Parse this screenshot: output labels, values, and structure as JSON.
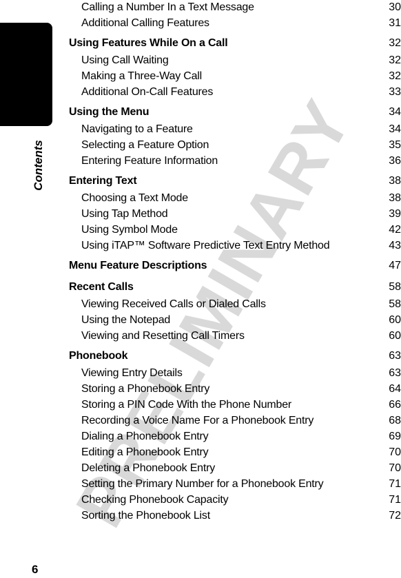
{
  "side_tab": {
    "label": "Contents"
  },
  "page_number": "6",
  "watermark": "PRELIMINARY",
  "toc": [
    {
      "level": "sub",
      "title": "Calling a Number In a Text Message",
      "page": "30"
    },
    {
      "level": "sub",
      "title": "Additional Calling Features",
      "page": "31"
    },
    {
      "level": "section",
      "title": "Using Features While On a Call",
      "page": "32"
    },
    {
      "level": "sub",
      "title": "Using Call Waiting",
      "page": "32"
    },
    {
      "level": "sub",
      "title": "Making a Three-Way Call",
      "page": "32"
    },
    {
      "level": "sub",
      "title": "Additional On-Call Features",
      "page": "33"
    },
    {
      "level": "section",
      "title": "Using the Menu",
      "page": "34"
    },
    {
      "level": "sub",
      "title": "Navigating to a Feature",
      "page": "34"
    },
    {
      "level": "sub",
      "title": "Selecting a Feature Option",
      "page": "35"
    },
    {
      "level": "sub",
      "title": "Entering Feature Information",
      "page": "36"
    },
    {
      "level": "section",
      "title": "Entering Text",
      "page": "38"
    },
    {
      "level": "sub",
      "title": "Choosing a Text Mode",
      "page": "38"
    },
    {
      "level": "sub",
      "title": "Using Tap Method",
      "page": "39"
    },
    {
      "level": "sub",
      "title": "Using Symbol Mode",
      "page": "42"
    },
    {
      "level": "sub",
      "title": "Using iTAP™ Software Predictive Text Entry Method",
      "page": "43"
    },
    {
      "level": "section",
      "title": "Menu Feature Descriptions",
      "page": "47"
    },
    {
      "level": "section",
      "title": "Recent Calls",
      "page": "58"
    },
    {
      "level": "sub",
      "title": "Viewing Received Calls or Dialed Calls",
      "page": "58"
    },
    {
      "level": "sub",
      "title": "Using the Notepad",
      "page": "60"
    },
    {
      "level": "sub",
      "title": "Viewing and Resetting Call Timers",
      "page": "60"
    },
    {
      "level": "section",
      "title": "Phonebook",
      "page": "63"
    },
    {
      "level": "sub",
      "title": "Viewing Entry Details",
      "page": "63"
    },
    {
      "level": "sub",
      "title": "Storing a Phonebook Entry",
      "page": "64"
    },
    {
      "level": "sub",
      "title": "Storing a PIN Code With the Phone Number",
      "page": "66"
    },
    {
      "level": "sub",
      "title": "Recording a Voice Name For a Phonebook Entry",
      "page": "68"
    },
    {
      "level": "sub",
      "title": "Dialing a Phonebook Entry",
      "page": "69"
    },
    {
      "level": "sub",
      "title": "Editing a Phonebook Entry",
      "page": "70"
    },
    {
      "level": "sub",
      "title": "Deleting a Phonebook Entry",
      "page": "70"
    },
    {
      "level": "sub",
      "title": "Setting the Primary Number for a Phonebook Entry",
      "page": "71"
    },
    {
      "level": "sub",
      "title": "Checking Phonebook Capacity",
      "page": "71"
    },
    {
      "level": "sub",
      "title": "Sorting the Phonebook List",
      "page": "72"
    }
  ]
}
